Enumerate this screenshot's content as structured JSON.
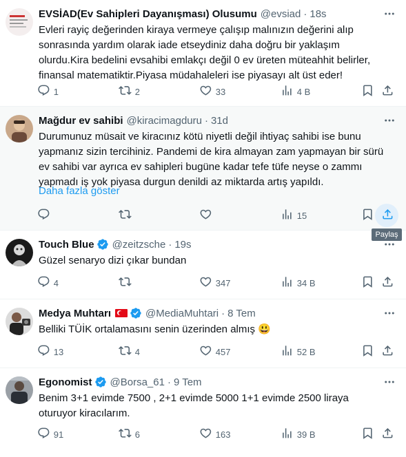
{
  "tweets": [
    {
      "name": "EVSİAD(Ev Sahipleri Dayanışması) Olusumu",
      "handle": "@evsiad",
      "time": "18s",
      "text": "Evleri rayiç değerinden kiraya vermeye çalışıp malınızın değerini alıp sonrasında yardım olarak iade etseydiniz daha doğru bir yaklaşım olurdu.Kira bedelini evsahibi emlakçı değil 0 ev üreten müteahhit belirler, finansal matematiktir.Piyasa müdahaleleri ise piyasayı alt üst eder!",
      "replies": "1",
      "retweets": "2",
      "likes": "33",
      "views": "4 B"
    },
    {
      "name": "Mağdur ev sahibi",
      "handle": "@kiracimagduru",
      "time": "31d",
      "text": "Durumunuz müsait ve kiracınız kötü niyetli değil ihtiyaç sahibi ise bunu yapmanız sizin tercihiniz. Pandemi de kira almayan zam yapmayan bir sürü ev sahibi var ayrıca ev sahipleri bugüne kadar tefe tüfe neyse o zammı yapmadı iş yok piyasa durgun denildi az miktarda artış yapıldı.",
      "show_more": "Daha fazla göster",
      "replies": "",
      "retweets": "",
      "likes": "",
      "views": "15"
    },
    {
      "name": "Touch Blue",
      "handle": "@zeitzsche",
      "time": "19s",
      "text": "Güzel senaryo dizi çıkar bundan",
      "replies": "4",
      "retweets": "",
      "likes": "347",
      "views": "34 B"
    },
    {
      "name": "Medya Muhtarı",
      "handle": "@MediaMuhtari",
      "time": "8 Tem",
      "text": "Belliki TÜİK ortalamasını senin üzerinden almış 😃",
      "replies": "13",
      "retweets": "4",
      "likes": "457",
      "views": "52 B"
    },
    {
      "name": "Egonomist",
      "handle": "@Borsa_61",
      "time": "9 Tem",
      "text": "Benim 3+1 evimde 7500 , 2+1 evimde 5000  1+1 evimde 2500 liraya oturuyor kiracılarım.",
      "replies": "91",
      "retweets": "6",
      "likes": "163",
      "views": "39 B"
    }
  ],
  "tooltip": "Paylaş",
  "colors": {
    "accent": "#1d9bf0",
    "muted": "#536471",
    "text": "#0f1419"
  },
  "icons": [
    "reply-icon",
    "retweet-icon",
    "like-icon",
    "views-icon",
    "bookmark-icon",
    "share-icon",
    "more-icon",
    "verified-icon"
  ]
}
